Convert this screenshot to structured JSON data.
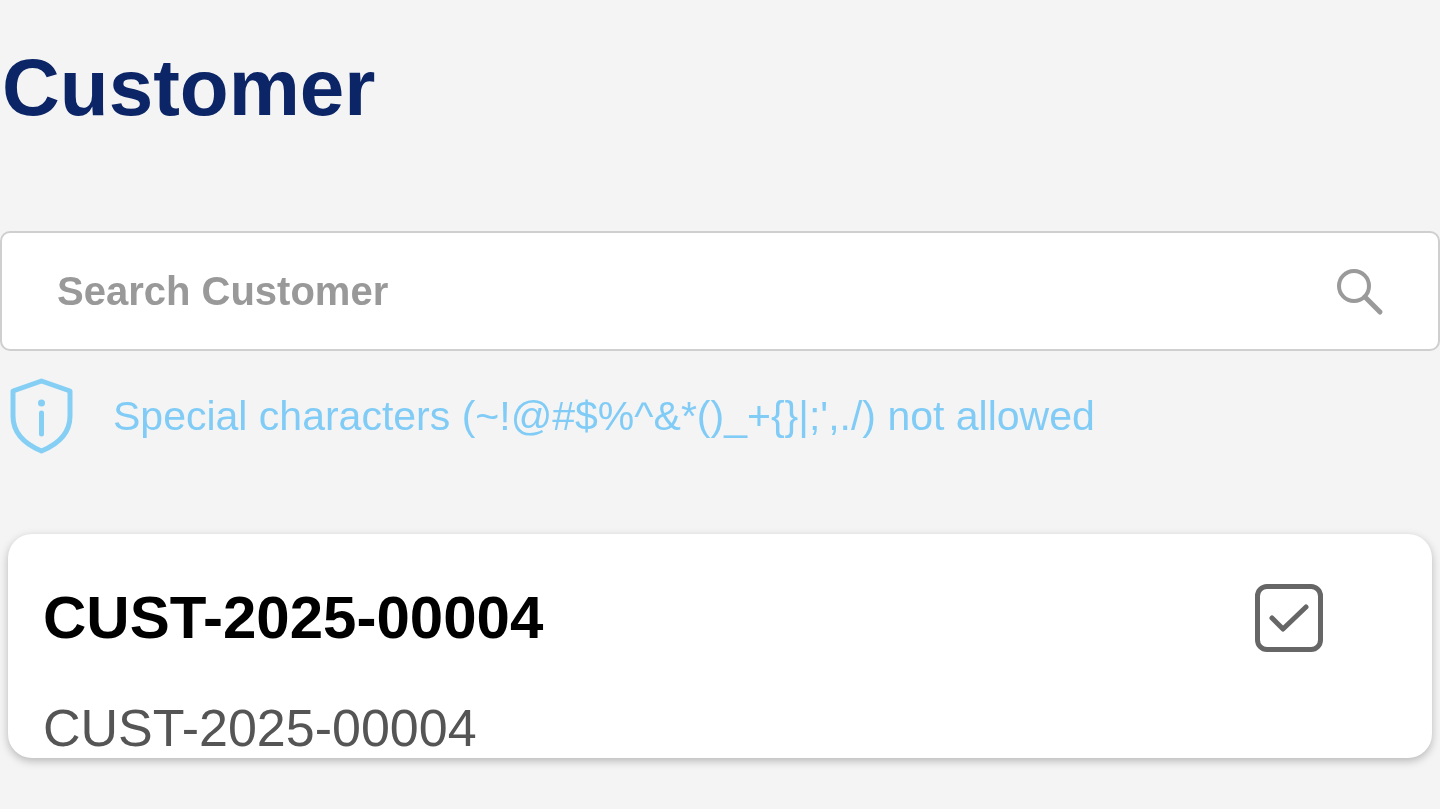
{
  "page": {
    "title": "Customer"
  },
  "search": {
    "placeholder": "Search Customer"
  },
  "hint": {
    "text": "Special characters (~!@#$%^&*()_+{}|;',./) not allowed"
  },
  "customers": [
    {
      "title": "CUST-2025-00004",
      "subtitle": "CUST-2025-00004",
      "checked": true
    }
  ]
}
